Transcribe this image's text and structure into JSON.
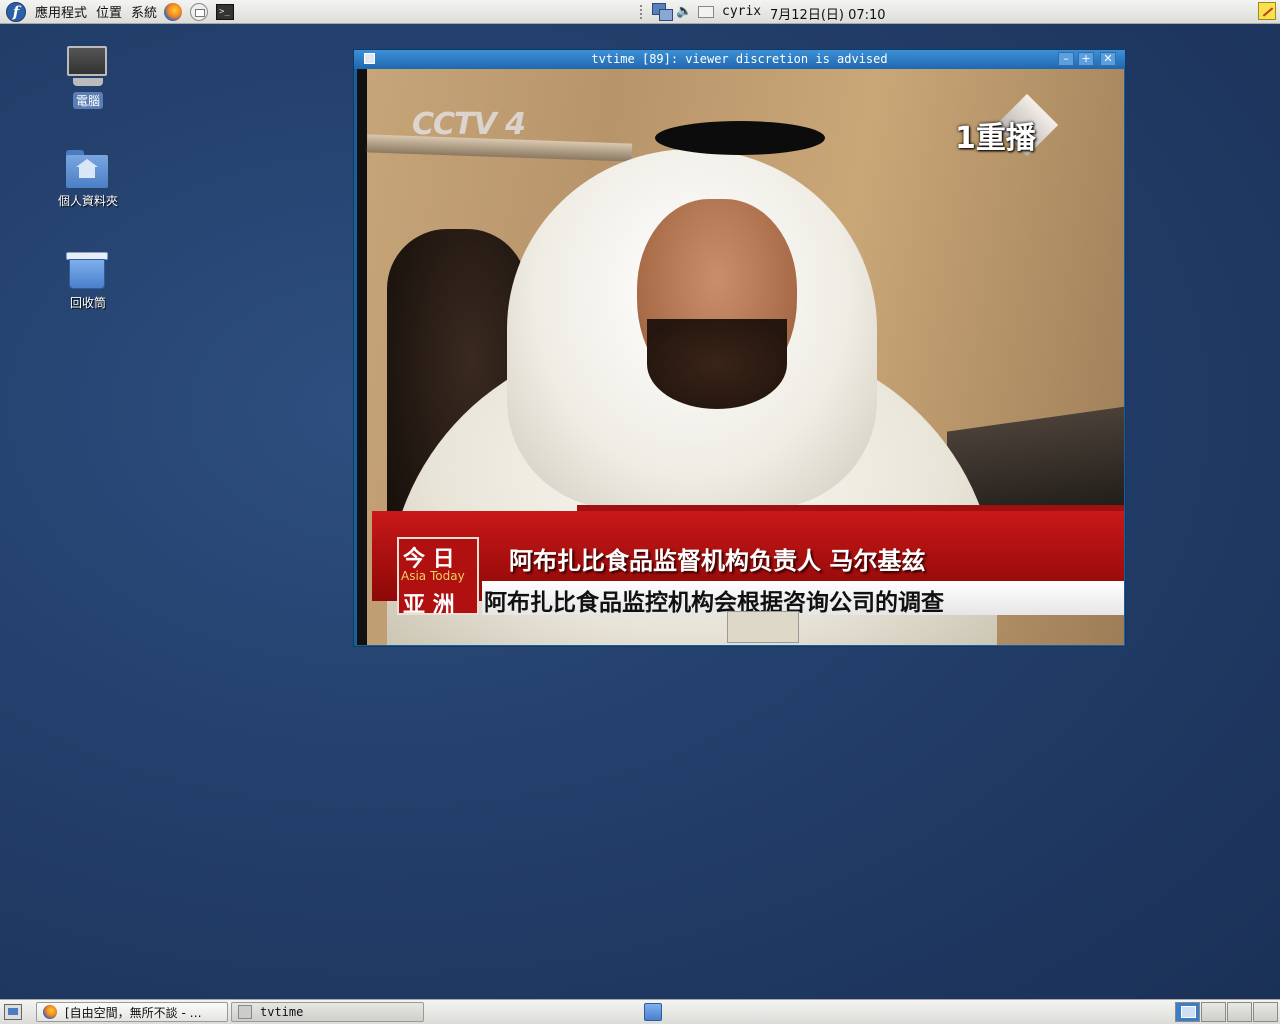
{
  "top_panel": {
    "logo_letter": "f",
    "menus": [
      "應用程式",
      "位置",
      "系統"
    ],
    "launchers": [
      "firefox-icon",
      "mail-icon",
      "terminal-icon"
    ],
    "terminal_glyph": ">_",
    "user": "cyrix",
    "clock": "7月12日(日) 07:10"
  },
  "desktop_icons": [
    {
      "label": "電腦",
      "icon": "computer-icon",
      "selected": true
    },
    {
      "label": "個人資料夾",
      "icon": "home-folder-icon",
      "selected": false
    },
    {
      "label": "回收筒",
      "icon": "trash-icon",
      "selected": false
    }
  ],
  "tv_window": {
    "title": "tvtime [89]: viewer discretion is advised",
    "buttons": {
      "minimize": "–",
      "maximize": "+",
      "close": "✕"
    },
    "video": {
      "channel_logo": "CCTV 4",
      "rerun_badge": "1重播",
      "caption_tag_top": "今 日",
      "caption_tag_sub": "Asia Today",
      "caption_tag_bottom": "亚 洲",
      "caption_line1": "阿布扎比食品监督机构负责人 马尔基兹",
      "caption_line2": "阿布扎比食品监控机构会根据咨询公司的调查"
    }
  },
  "taskbar": {
    "tasks": [
      {
        "label": "[自由空間，無所不談 - …",
        "icon": "firefox-icon",
        "active": false
      },
      {
        "label": "tvtime",
        "icon": "tvtime-icon",
        "active": true
      }
    ],
    "workspaces": 4,
    "active_workspace": 1
  },
  "colors": {
    "desktop": "#233f6b",
    "titlebar": "#2f7cc4",
    "caption_red": "#b81212"
  }
}
